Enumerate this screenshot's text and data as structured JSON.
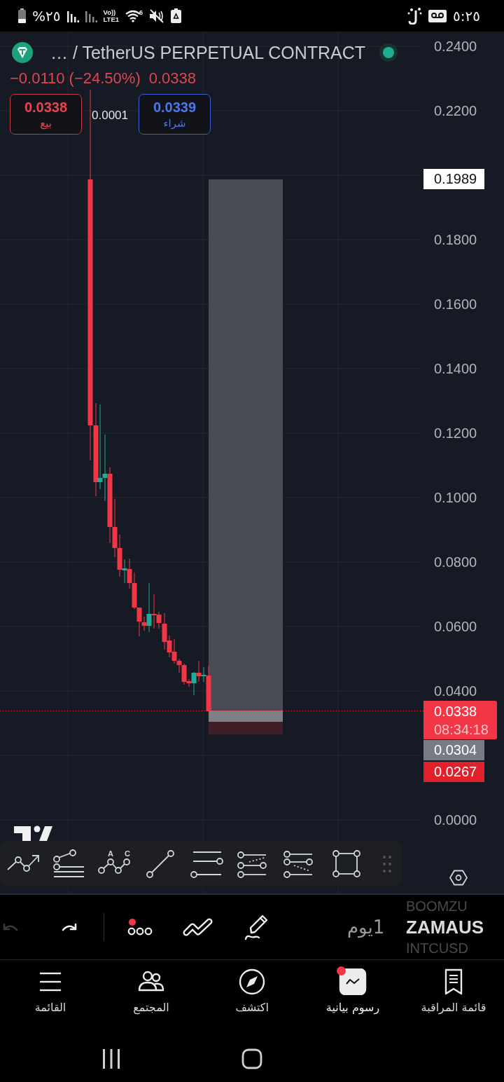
{
  "status_bar": {
    "battery": "%٢٥",
    "network": "Vo))",
    "network_type": "LTE1",
    "wifi_band": "6",
    "time": "٥:٢٥"
  },
  "chart": {
    "symbol": "… / TetherUS PERPETUAL CONTRACT",
    "market_open": true,
    "change": "−0.0110 (−24.50%)",
    "last_price": "0.0338",
    "sell": {
      "price": "0.0338",
      "label": "بيع"
    },
    "spread": "0.0001",
    "buy": {
      "price": "0.0339",
      "label": "شراء"
    },
    "price_axis": [
      "0.2400",
      "0.2200",
      "0.1800",
      "0.1600",
      "0.1400",
      "0.1200",
      "0.1000",
      "0.0800",
      "0.0600",
      "0.0400",
      "0.0000"
    ],
    "price_tags": [
      {
        "kind": "target",
        "price": "0.1989"
      },
      {
        "kind": "last",
        "price": "0.0338",
        "countdown": "08:34:18"
      },
      {
        "kind": "entry",
        "price": "0.0304"
      },
      {
        "kind": "stop",
        "price": "0.0267"
      }
    ]
  },
  "drawing_tools": [
    {
      "kind": "trend-arrow"
    },
    {
      "kind": "fib"
    },
    {
      "kind": "abcd",
      "letters": [
        "A",
        "C"
      ]
    },
    {
      "kind": "line"
    },
    {
      "kind": "horizontal"
    },
    {
      "kind": "channel"
    },
    {
      "kind": "pitch"
    },
    {
      "kind": "rectangle"
    }
  ],
  "bottom_bar": {
    "history": [
      {
        "kind": "undo",
        "disabled": true
      },
      {
        "kind": "redo",
        "disabled": false
      }
    ],
    "tools": [
      {
        "kind": "more",
        "badge": true
      },
      {
        "kind": "patterns",
        "badge": false
      },
      {
        "kind": "pencil",
        "badge": false
      }
    ],
    "interval": "1يوم",
    "symbols": [
      {
        "text": "BOOMZU",
        "selected": false
      },
      {
        "text": "ZAMAUS",
        "selected": true
      },
      {
        "text": "INTCUSD",
        "selected": false
      }
    ]
  },
  "nav": [
    {
      "kind": "watchlist",
      "label": "قائمة المراقبة",
      "selected": false,
      "badge": false
    },
    {
      "kind": "charts",
      "label": "رسوم بيانية",
      "selected": true,
      "badge": true
    },
    {
      "kind": "explore",
      "label": "اكتشف",
      "selected": false,
      "badge": false
    },
    {
      "kind": "community",
      "label": "المجتمع",
      "selected": false,
      "badge": false
    },
    {
      "kind": "menu",
      "label": "القائمة",
      "selected": false,
      "badge": false
    }
  ],
  "system_nav": [
    {
      "kind": "recents"
    },
    {
      "kind": "home"
    }
  ]
}
